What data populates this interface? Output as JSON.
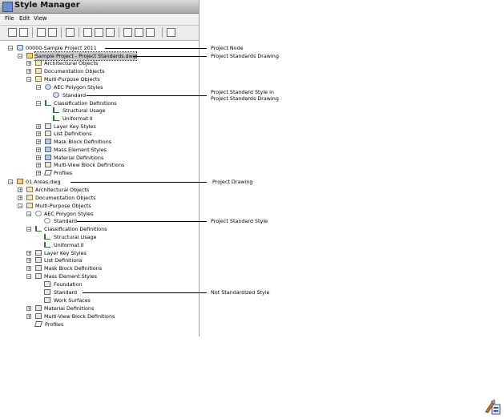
{
  "window": {
    "title": "Style Manager"
  },
  "menu": {
    "file": "File",
    "edit": "Edit",
    "view": "View"
  },
  "tree": {
    "project": "00000-Sample Project 2011",
    "standards_drawing": "Sample Project - Project Standards.dwg",
    "std_arch": "Architectural Objects",
    "std_doc": "Documentation Objects",
    "std_multi": "Multi-Purpose Objects",
    "std_aec_poly": "AEC Polygon Styles",
    "std_standard": "Standard",
    "std_class": "Classification Definitions",
    "std_struct": "Structural Usage",
    "std_uniformat": "Uniformat II",
    "std_layer": "Layer Key Styles",
    "std_list": "List Definitions",
    "std_mask": "Mask Block Definitions",
    "std_mass": "Mass Element Styles",
    "std_material": "Material Definitions",
    "std_mvb": "Multi-View Block Definitions",
    "std_profiles": "Profiles",
    "drawing": "01 Areas.dwg",
    "d_arch": "Architectural Objects",
    "d_doc": "Documentation Objects",
    "d_multi": "Multi-Purpose Objects",
    "d_aec_poly": "AEC Polygon Styles",
    "d_standard": "Standard",
    "d_class": "Classification Definitions",
    "d_struct": "Structural Usage",
    "d_uniformat": "Uniformat II",
    "d_layer": "Layer Key Styles",
    "d_list": "List Definitions",
    "d_mask": "Mask Block Definitions",
    "d_mass": "Mass Element Styles",
    "d_foundation": "Foundation",
    "d_mass_standard": "Standard",
    "d_work": "Work Surfaces",
    "d_material": "Material Definitions",
    "d_mvb": "Multi-View Block Definitions",
    "d_profiles": "Profiles"
  },
  "callouts": {
    "project_node": "Project Node",
    "project_standards_drawing": "Project Standards Drawing",
    "project_standard_style_in": "Project Standard Style in",
    "project_standards_drawing_2": "Project Standards Drawing",
    "project_drawing": "Project Drawing",
    "project_standard_style": "Project Standard Style",
    "not_standardized_style": "Not Standardized Style"
  },
  "colors": {
    "selection": "#c8c8c8",
    "titlebar": "#a9a9a9"
  }
}
